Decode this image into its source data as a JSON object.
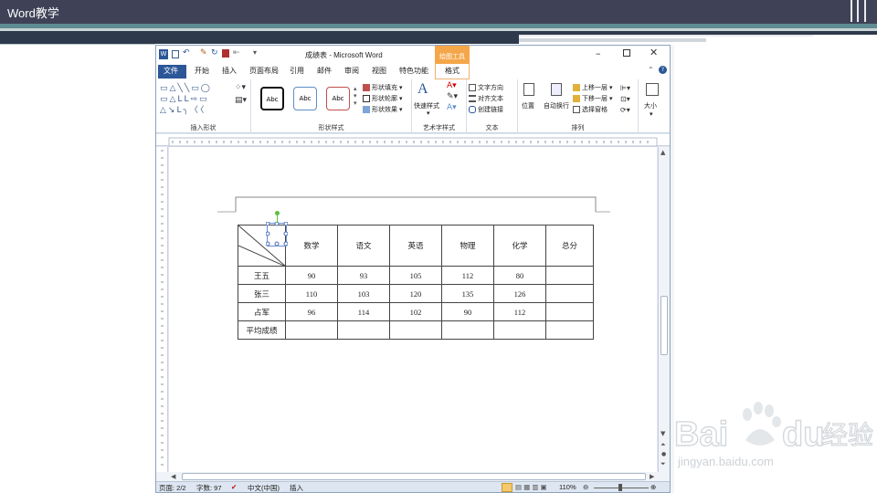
{
  "slide": {
    "title": "Word教学"
  },
  "word": {
    "doc_title": "成绩表 - Microsoft Word",
    "context_tab_group": "绘图工具",
    "tabs": [
      "文件",
      "开始",
      "插入",
      "页面布局",
      "引用",
      "邮件",
      "审阅",
      "视图",
      "特色功能",
      "格式"
    ],
    "ribbon": {
      "groups": {
        "insert_shapes": "插入形状",
        "shape_styles": "形状样式",
        "wordart_styles": "艺术字样式",
        "text": "文本",
        "arrange": "排列",
        "size": "大小"
      },
      "shape_sample": "Abc",
      "shape_fill": "形状填充",
      "shape_outline": "形状轮廓",
      "shape_effects": "形状效果",
      "quick_styles": "快速样式",
      "text_direction": "文字方向",
      "align_text": "对齐文本",
      "create_link": "创建链接",
      "position": "位置",
      "wrap_text": "自动换行",
      "bring_forward": "上移一层",
      "send_backward": "下移一层",
      "selection_pane": "选择窗格",
      "size_label": "大小"
    },
    "status": {
      "page": "页面: 2/2",
      "words": "字数: 97",
      "language": "中文(中国)",
      "mode": "插入",
      "zoom": "110%"
    }
  },
  "table": {
    "header": [
      "数学",
      "语文",
      "英语",
      "物理",
      "化学",
      "总分"
    ],
    "rows": [
      {
        "name": "王五",
        "values": [
          "90",
          "93",
          "105",
          "112",
          "80",
          ""
        ]
      },
      {
        "name": "张三",
        "values": [
          "110",
          "103",
          "120",
          "135",
          "126",
          ""
        ]
      },
      {
        "name": "占军",
        "values": [
          "96",
          "114",
          "102",
          "90",
          "112",
          ""
        ]
      },
      {
        "name": "平均成绩",
        "values": [
          "",
          "",
          "",
          "",
          "",
          ""
        ]
      }
    ]
  },
  "watermark": {
    "brand_a": "Bai",
    "brand_b": "du",
    "brand_cn": "经验",
    "url": "jingyan.baidu.com"
  },
  "colors": {
    "slide_header": "#3f4257",
    "accent_teal": "#5e8c92",
    "context_tab": "#f5a64a",
    "file_tab": "#2b5797"
  }
}
